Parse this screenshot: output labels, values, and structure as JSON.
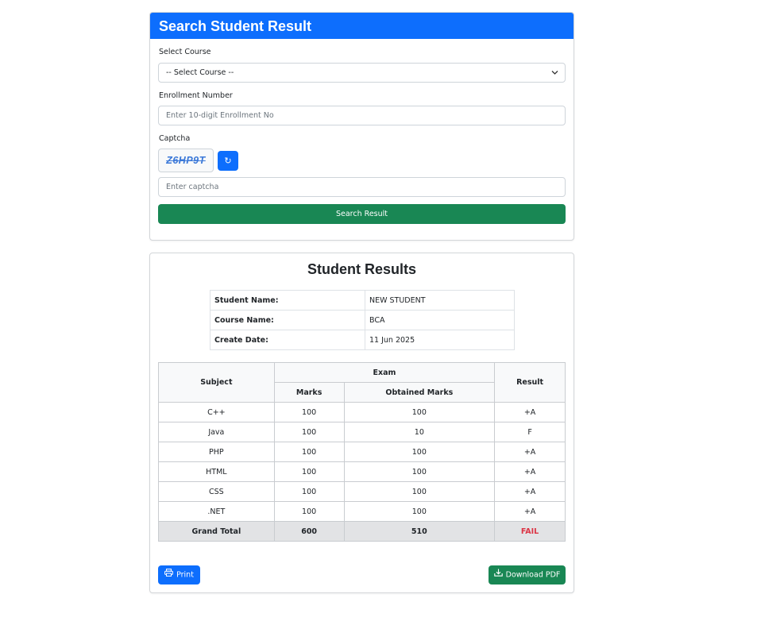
{
  "search": {
    "title": "Search Student Result",
    "course_label": "Select Course",
    "course_selected": "-- Select Course --",
    "enrollment_label": "Enrollment Number",
    "enrollment_placeholder": "Enter 10-digit Enrollment No",
    "captcha_label": "Captcha",
    "captcha_code": "Z6HP9T",
    "refresh_icon": "↻",
    "captcha_placeholder": "Enter captcha",
    "submit_label": "Search Result"
  },
  "results": {
    "title": "Student Results",
    "info": [
      {
        "key": "Student Name:",
        "value": "NEW STUDENT"
      },
      {
        "key": "Course Name:",
        "value": "BCA"
      },
      {
        "key": "Create Date:",
        "value": "11 Jun 2025"
      }
    ],
    "headers": {
      "subject": "Subject",
      "exam": "Exam",
      "marks": "Marks",
      "obtained": "Obtained Marks",
      "result": "Result"
    },
    "rows": [
      {
        "subject": "C++",
        "marks": "100",
        "obtained": "100",
        "result": "+A"
      },
      {
        "subject": "Java",
        "marks": "100",
        "obtained": "10",
        "result": "F"
      },
      {
        "subject": "PHP",
        "marks": "100",
        "obtained": "100",
        "result": "+A"
      },
      {
        "subject": "HTML",
        "marks": "100",
        "obtained": "100",
        "result": "+A"
      },
      {
        "subject": "CSS",
        "marks": "100",
        "obtained": "100",
        "result": "+A"
      },
      {
        "subject": ".NET",
        "marks": "100",
        "obtained": "100",
        "result": "+A"
      }
    ],
    "total": {
      "label": "Grand Total",
      "marks": "600",
      "obtained": "510",
      "result": "FAIL"
    },
    "print_label": "Print",
    "pdf_label": "Download PDF"
  },
  "colors": {
    "primary": "#0d6efd",
    "success": "#198754",
    "danger": "#dc3545"
  }
}
